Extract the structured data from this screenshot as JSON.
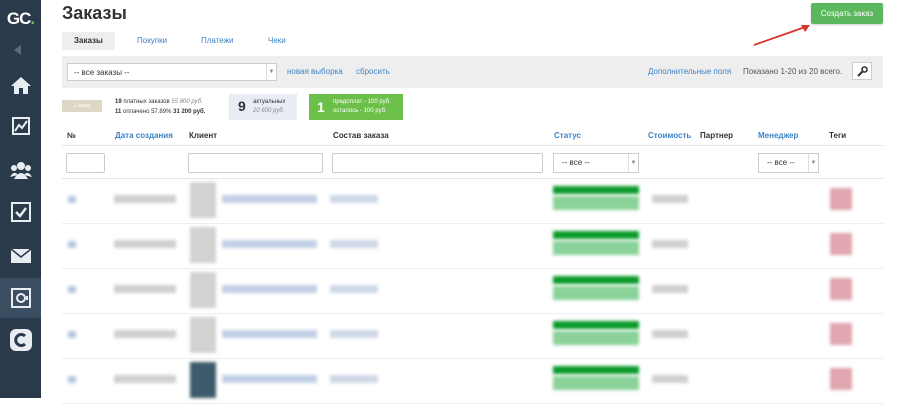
{
  "app": {
    "logo_text": "GC",
    "logo_dot": "."
  },
  "sidebar": {
    "items": [
      {
        "icon": "home-icon"
      },
      {
        "icon": "chart-icon"
      },
      {
        "icon": "users-icon"
      },
      {
        "icon": "checkbox-icon"
      },
      {
        "icon": "mail-icon"
      },
      {
        "icon": "safe-icon"
      },
      {
        "icon": "getcourse-icon"
      }
    ]
  },
  "header": {
    "title": "Заказы",
    "create_button": "Создать заказ"
  },
  "tabs": [
    {
      "label": "Заказы",
      "active": true
    },
    {
      "label": "Покупки"
    },
    {
      "label": "Платежи"
    },
    {
      "label": "Чеки"
    }
  ],
  "filter_bar": {
    "select_value": "-- все заказы --",
    "new_selection": "новая выборка",
    "reset": "сбросить",
    "extra_fields": "Дополнительные поля",
    "shown": "Показано 1-20 из 20 всего."
  },
  "stats": {
    "all_badge": "1 заказ",
    "paid_count": "19",
    "paid_label": "платных заказов",
    "paid_sum": "55 800 руб.",
    "payed_count": "11",
    "payed_label": "оплачено 57.89%",
    "payed_sum": "31 200 руб.",
    "actual_count": "9",
    "actual_label": "актуальных",
    "actual_sum": "20 600 руб.",
    "prepaid_count": "1",
    "prepaid_label": "предоплат - 100 руб.",
    "remaining_label": "осталось - 100 руб."
  },
  "table": {
    "columns": [
      "№",
      "Дата создания",
      "Клиент",
      "Состав заказа",
      "Статус",
      "Стоимость",
      "Партнер",
      "Менеджер",
      "Теги"
    ],
    "status_filter": "-- все --",
    "manager_filter": "-- все --",
    "rows": [
      {},
      {},
      {},
      {},
      {}
    ]
  },
  "colors": {
    "sidebar": "#2b3a4a",
    "accent_green": "#5cb85c",
    "link": "#3d84c6",
    "arrow": "#d9342b"
  }
}
